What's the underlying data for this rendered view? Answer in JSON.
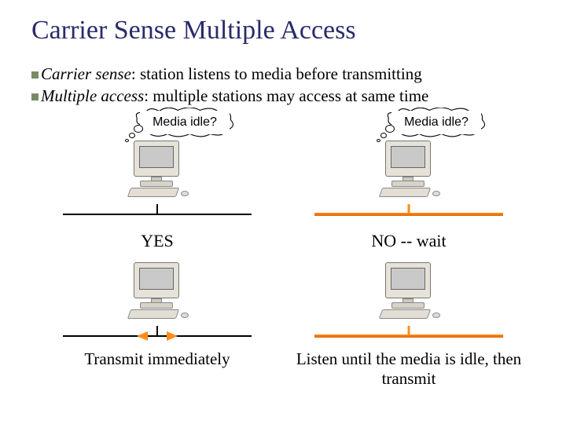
{
  "title": "Carrier Sense Multiple Access",
  "bullets": [
    {
      "term": "Carrier sense",
      "def": ":  station listens to media before transmitting"
    },
    {
      "term": "Multiple access",
      "def": ":  multiple stations may access at same time"
    }
  ],
  "cloud_text": "Media idle?",
  "left": {
    "answer": "YES",
    "caption": "Transmit immediately"
  },
  "right": {
    "answer": "NO -- wait",
    "caption": "Listen until the media is idle, then transmit"
  }
}
